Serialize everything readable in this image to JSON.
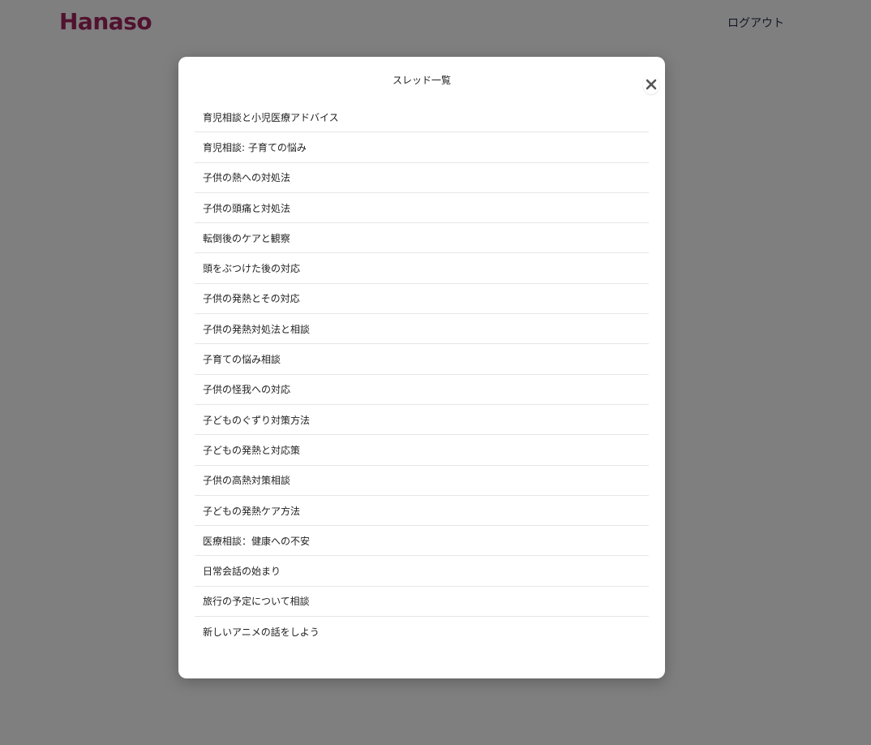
{
  "header": {
    "logo": "Hanaso",
    "logout_label": "ログアウト"
  },
  "modal": {
    "title": "スレッド一覧",
    "close_icon": "close-icon",
    "threads": [
      {
        "title": "育児相談と小児医療アドバイス"
      },
      {
        "title": "育児相談: 子育ての悩み"
      },
      {
        "title": "子供の熱への対処法"
      },
      {
        "title": "子供の頭痛と対処法"
      },
      {
        "title": "転倒後のケアと観察"
      },
      {
        "title": "頭をぶつけた後の対応"
      },
      {
        "title": "子供の発熱とその対応"
      },
      {
        "title": "子供の発熱対処法と相談"
      },
      {
        "title": "子育ての悩み相談"
      },
      {
        "title": "子供の怪我への対応"
      },
      {
        "title": "子どものぐずり対策方法"
      },
      {
        "title": "子どもの発熱と対応策"
      },
      {
        "title": "子供の高熱対策相談"
      },
      {
        "title": "子どもの発熱ケア方法"
      },
      {
        "title": "医療相談：健康への不安"
      },
      {
        "title": "日常会話の始まり"
      },
      {
        "title": "旅行の予定について相談"
      },
      {
        "title": "新しいアニメの話をしよう"
      }
    ]
  },
  "colors": {
    "brand": "#a3245e",
    "overlay": "rgba(0,0,0,0.5)",
    "divider": "#e6e6e6"
  }
}
